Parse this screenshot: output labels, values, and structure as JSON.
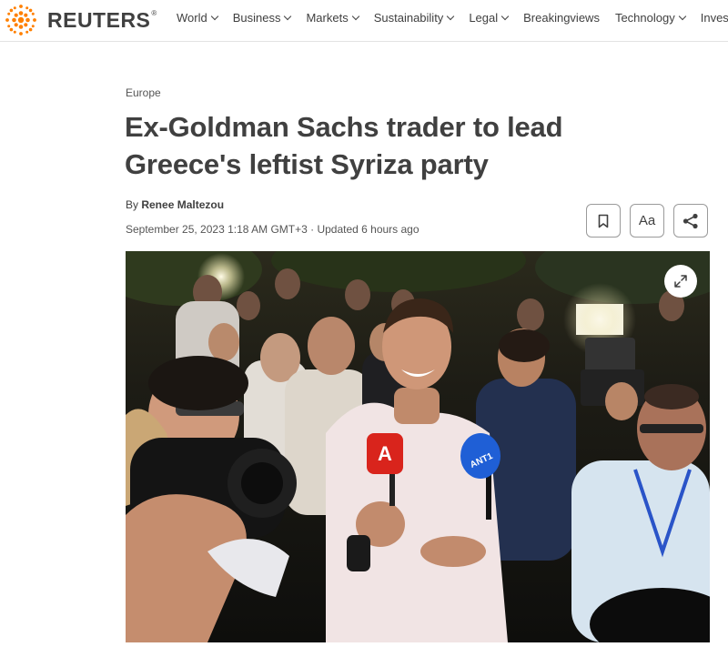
{
  "brand": {
    "name": "REUTERS",
    "registered": "®",
    "logo_icon": "reuters-dot-logo-icon",
    "logo_color": "#ff8000"
  },
  "nav": {
    "items": [
      {
        "label": "World",
        "has_dropdown": true
      },
      {
        "label": "Business",
        "has_dropdown": true
      },
      {
        "label": "Markets",
        "has_dropdown": true
      },
      {
        "label": "Sustainability",
        "has_dropdown": true
      },
      {
        "label": "Legal",
        "has_dropdown": true
      },
      {
        "label": "Breakingviews",
        "has_dropdown": false
      },
      {
        "label": "Technology",
        "has_dropdown": true
      },
      {
        "label": "Invest",
        "has_dropdown": false
      }
    ]
  },
  "article": {
    "section": "Europe",
    "headline": "Ex-Goldman Sachs trader to lead Greece's leftist Syriza party",
    "byline_prefix": "By ",
    "author": "Renee Maltezou",
    "dateline": "September 25, 2023 1:18 AM GMT+3 · Updated 6 hours ago"
  },
  "tools": {
    "bookmark_icon": "bookmark-icon",
    "text_size_label": "Aa",
    "share_icon": "share-icon"
  },
  "photo": {
    "expand_icon": "expand-icon",
    "mic_red_logo": "A",
    "mic_blue_logo": "ANT1"
  },
  "colors": {
    "text": "#404040",
    "border": "#9a9a9a",
    "mic_red": "#d9241c",
    "mic_blue": "#1f5fd6"
  }
}
